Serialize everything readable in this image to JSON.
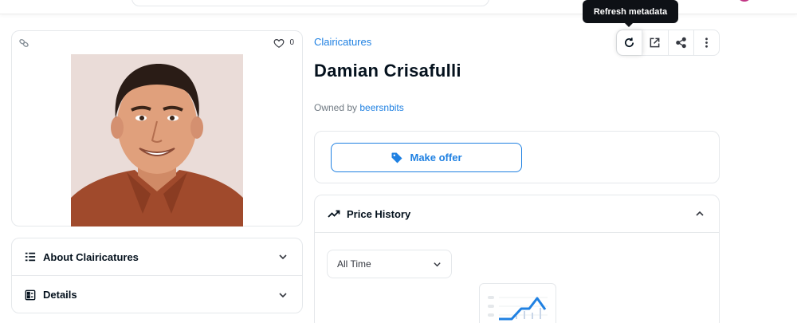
{
  "nft": {
    "collection": "Clairicatures",
    "title": "Damian Crisafulli",
    "owned_by_label": "Owned by",
    "owner": "beersnbits",
    "favorites": "0"
  },
  "tooltip": {
    "text": "Refresh metadata"
  },
  "actions": [
    {
      "name": "refresh",
      "icon": "refresh-icon"
    },
    {
      "name": "open-external",
      "icon": "external-link-icon"
    },
    {
      "name": "share",
      "icon": "share-icon"
    },
    {
      "name": "more",
      "icon": "more-vertical-icon"
    }
  ],
  "accordion": {
    "about_label": "About Clairicatures",
    "details_label": "Details"
  },
  "offer": {
    "button_label": "Make offer"
  },
  "price_history": {
    "title": "Price History",
    "range_selected": "All Time"
  },
  "colors": {
    "accent": "#2081e2",
    "text": "#04111d",
    "muted": "#707a83",
    "border": "#e5e8eb",
    "tooltip_bg": "#0e1116"
  }
}
